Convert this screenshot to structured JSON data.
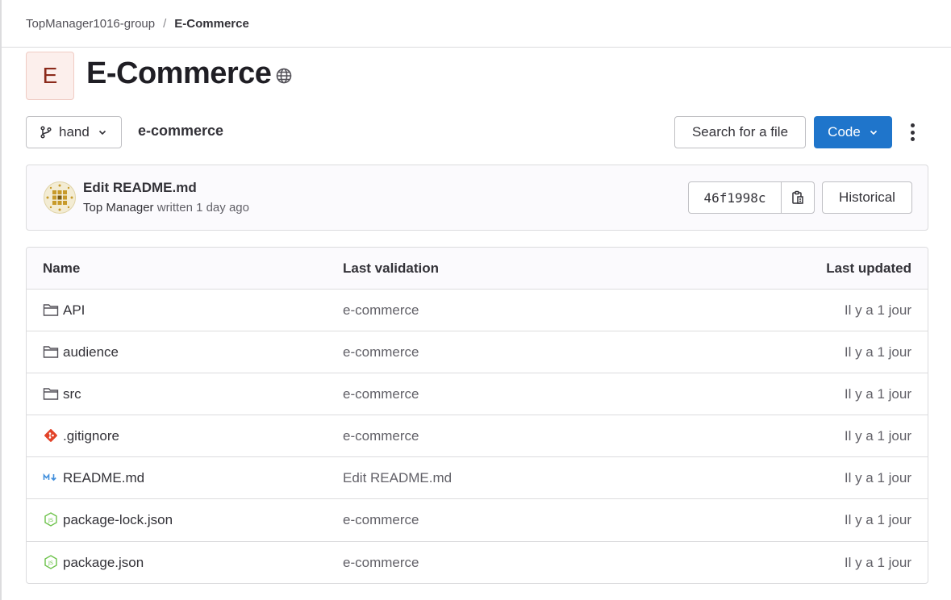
{
  "breadcrumb": {
    "group": "TopManager1016-group",
    "separator": "/",
    "project": "E-Commerce"
  },
  "project": {
    "avatar_letter": "E",
    "title": "E-Commerce",
    "visibility_icon": "globe-icon"
  },
  "toolbar": {
    "branch": "hand",
    "path": "e-commerce",
    "search_label": "Search for a file",
    "code_label": "Code"
  },
  "commit": {
    "title": "Edit README.md",
    "author": "Top Manager",
    "meta": "written 1 day ago",
    "sha": "46f1998c",
    "history_label": "Historical"
  },
  "table": {
    "headers": {
      "name": "Name",
      "last_commit": "Last validation",
      "last_updated": "Last updated"
    },
    "rows": [
      {
        "icon": "folder-icon",
        "name": "API",
        "commit": "e-commerce",
        "updated": "Il y a 1 jour"
      },
      {
        "icon": "folder-icon",
        "name": "audience",
        "commit": "e-commerce",
        "updated": "Il y a 1 jour"
      },
      {
        "icon": "folder-icon",
        "name": "src",
        "commit": "e-commerce",
        "updated": "Il y a 1 jour"
      },
      {
        "icon": "git-icon",
        "name": ".gitignore",
        "commit": "e-commerce",
        "updated": "Il y a 1 jour"
      },
      {
        "icon": "markdown-icon",
        "name": "README.md",
        "commit": "Edit README.md",
        "updated": "Il y a 1 jour"
      },
      {
        "icon": "nodejs-icon",
        "name": "package-lock.json",
        "commit": "e-commerce",
        "updated": "Il y a 1 jour"
      },
      {
        "icon": "nodejs-icon",
        "name": "package.json",
        "commit": "e-commerce",
        "updated": "Il y a 1 jour"
      }
    ]
  },
  "colors": {
    "primary": "#1f75cb",
    "avatar_bg": "#fcefec",
    "text": "#333238",
    "muted": "#626168",
    "border": "#dcdcde"
  }
}
